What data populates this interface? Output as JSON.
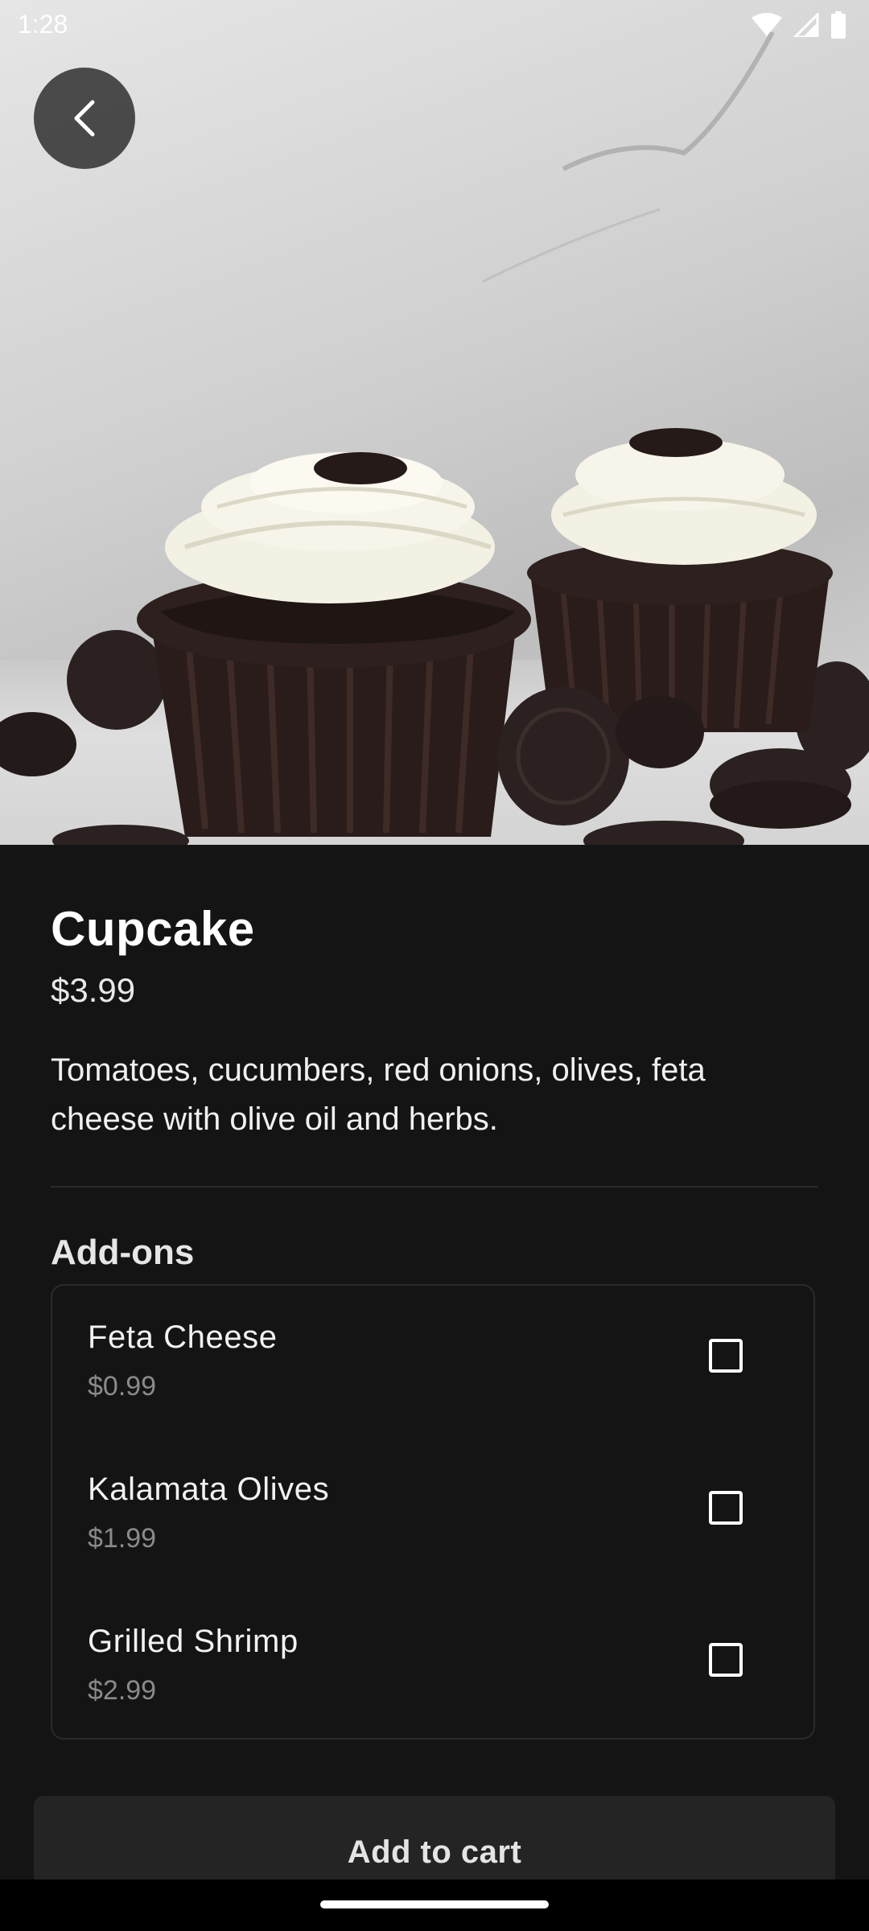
{
  "status_bar": {
    "time": "1:28",
    "icons": [
      "wifi-icon",
      "signal-icon",
      "battery-icon"
    ]
  },
  "hero": {
    "image": "photo of chocolate cupcakes with white frosting and cookies",
    "back_icon": "chevron-left-icon"
  },
  "product": {
    "name": "Cupcake",
    "price": "$3.99",
    "description": "Tomatoes, cucumbers, red onions, olives, feta cheese with olive oil and herbs."
  },
  "addons": {
    "title": "Add-ons",
    "items": [
      {
        "name": "Feta Cheese",
        "price": "$0.99",
        "checked": false
      },
      {
        "name": "Kalamata Olives",
        "price": "$1.99",
        "checked": false
      },
      {
        "name": "Grilled Shrimp",
        "price": "$2.99",
        "checked": false
      }
    ]
  },
  "cart_button": {
    "label": "Add to cart"
  },
  "colors": {
    "background": "#141414",
    "card_border": "#2b2b2b",
    "button_bg": "#242424",
    "muted_text": "#8a8a8a"
  }
}
